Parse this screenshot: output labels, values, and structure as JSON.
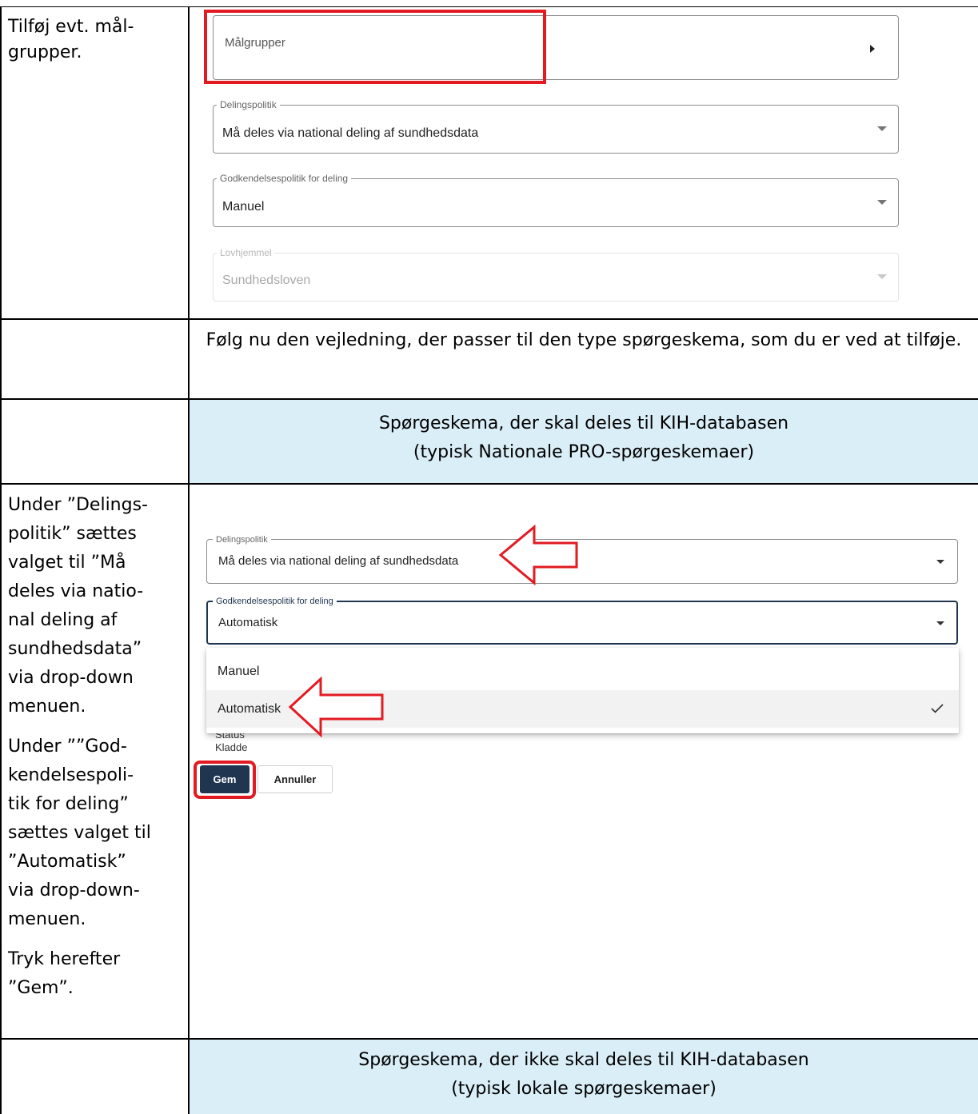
{
  "rows": [
    {
      "instruction": "Tilføj evt. mål-grupper."
    },
    {
      "text": "Følg nu den vejledning, der passer til den type spørgeskema, som du er ved at tilføje."
    },
    {
      "heading_line1": "Spørgeskema, der skal deles til KIH-databasen",
      "heading_line2": "(typisk Nationale PRO-spørgeskemaer)"
    },
    {
      "instruction_lines": [
        "Under ”Delings-",
        "politik” sættes",
        "valget til ”Må",
        "deles via natio-",
        "nal deling af",
        "sundhedsdata”",
        "via drop-down",
        "menuen."
      ],
      "instruction2_lines": [
        "Under ””God-",
        "kendelsespoli-",
        "tik for deling”",
        "sættes valget til",
        "”Automatisk”",
        "via drop-down-",
        "menuen."
      ],
      "instruction3_lines": [
        "Tryk herefter",
        "”Gem”."
      ]
    },
    {
      "heading_line1": "Spørgeskema, der ikke skal deles til KIH-databasen",
      "heading_line2": "(typisk lokale spørgeskemaer)"
    }
  ],
  "form1": {
    "maalgrupper_label": "Målgrupper",
    "delingspolitik_label": "Delingspolitik",
    "delingspolitik_value": "Må deles via national deling af sundhedsdata",
    "godkendelse_label": "Godkendelsespolitik for deling",
    "godkendelse_value": "Manuel",
    "lovhjemmel_label": "Lovhjemmel",
    "lovhjemmel_value": "Sundhedsloven"
  },
  "form2": {
    "delingspolitik_label": "Delingspolitik",
    "delingspolitik_value": "Må deles via national deling af sundhedsdata",
    "godkendelse_label": "Godkendelsespolitik for deling",
    "godkendelse_value": "Automatisk",
    "menu_options": [
      "Manuel",
      "Automatisk"
    ],
    "status_label": "Status",
    "status_value": "Kladde",
    "save_label": "Gem",
    "cancel_label": "Annuller"
  },
  "colors": {
    "highlight_red": "#e21b23",
    "heading_bg": "#daeef8",
    "primary_button": "#1f3550"
  },
  "icons": {
    "expand": "triangle-right-icon",
    "dropdown": "caret-down-icon",
    "selected": "check-icon",
    "pointer": "red-outline-arrow-icon"
  }
}
